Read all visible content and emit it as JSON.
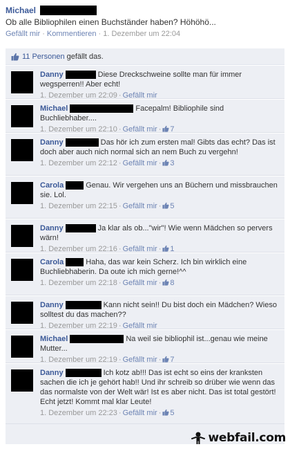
{
  "post": {
    "author": "Michael",
    "text": "Ob alle Bibliophilen einen Buchständer haben? Höhöhö...",
    "like_label": "Gefällt mir",
    "comment_label": "Kommentieren",
    "timestamp": "1. Dezember um 22:04"
  },
  "likes": {
    "people_link": "11 Personen",
    "suffix": "gefällt das."
  },
  "comments": [
    {
      "author": "Danny",
      "text": "Diese Dreckschweine sollte man für immer wegsperren!! Aber echt!",
      "time": "1. Dezember um 22:09",
      "like_label": "Gefällt mir",
      "likes": ""
    },
    {
      "author": "Michael",
      "text": "Facepalm! Bibliophile sind Buchliebhaber....",
      "time": "1. Dezember um 22:10",
      "like_label": "Gefällt mir",
      "likes": "7"
    },
    {
      "author": "Danny",
      "text": "Das hör ich zum ersten mal! Gibts das echt? Das ist doch aber auch nich normal sich an nem Buch zu vergehn!",
      "time": "1. Dezember um 22:12",
      "like_label": "Gefällt mir",
      "likes": "3"
    },
    {
      "author": "Carola",
      "text": "Genau. Wir vergehen uns an Büchern und missbrauchen sie. Lol.",
      "time": "1. Dezember um 22:15",
      "like_label": "Gefällt mir",
      "likes": "5"
    },
    {
      "author": "Danny",
      "text": "Ja klar als ob...\"wir\"! Wie wenn Mädchen so pervers wärn!",
      "time": "1. Dezember um 22:16",
      "like_label": "Gefällt mir",
      "likes": "1"
    },
    {
      "author": "Carola",
      "text": "Haha, das war kein Scherz. Ich bin wirklich eine Buchliebhaberin. Da oute ich mich gerne!^^",
      "time": "1. Dezember um 22:18",
      "like_label": "Gefällt mir",
      "likes": "8"
    },
    {
      "author": "Danny",
      "text": "Kann nicht sein!! Du bist doch ein Mädchen? Wieso solltest du das machen??",
      "time": "1. Dezember um 22:19",
      "like_label": "Gefällt mir",
      "likes": ""
    },
    {
      "author": "Michael",
      "text": "Na weil sie bibliophil ist...genau wie meine Mutter...",
      "time": "1. Dezember um 22:19",
      "like_label": "Gefällt mir",
      "likes": "7"
    },
    {
      "author": "Danny",
      "text": "Ich kotz ab!!! Das ist echt so eins der kranksten sachen die ich je gehört hab!! Und ihr schreib so drüber wie wenn das das normalste von der Welt wär! Ist es aber nicht. Das ist total gestört! Echt jetzt! Kommt mal klar Leute!",
      "time": "1. Dezember um 22:23",
      "like_label": "Gefällt mir",
      "likes": "5"
    }
  ],
  "watermark": "webfail.com",
  "colors": {
    "link": "#3b5998",
    "meta": "#999999",
    "feed_bg": "#edeff4"
  }
}
